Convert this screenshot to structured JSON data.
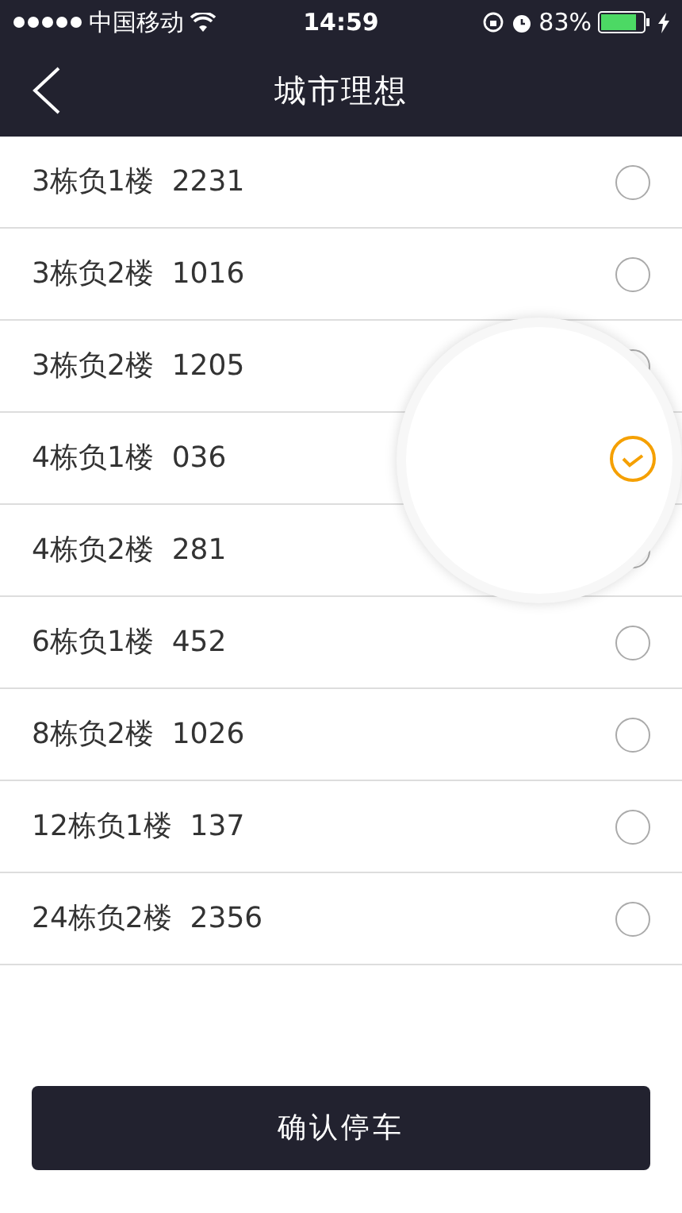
{
  "status_bar": {
    "carrier": "中国移动",
    "time": "14:59",
    "battery": "83%"
  },
  "nav": {
    "title": "城市理想"
  },
  "spots": [
    {
      "label": "3栋负1楼  2231",
      "selected": false
    },
    {
      "label": "3栋负2楼  1016",
      "selected": false
    },
    {
      "label": "3栋负2楼  1205",
      "selected": false
    },
    {
      "label": "4栋负1楼  036",
      "selected": true
    },
    {
      "label": "4栋负2楼  281",
      "selected": false
    },
    {
      "label": "6栋负1楼  452",
      "selected": false
    },
    {
      "label": "8栋负2楼  1026",
      "selected": false
    },
    {
      "label": "12栋负1楼  137",
      "selected": false
    },
    {
      "label": "24栋负2楼  2356",
      "selected": false
    }
  ],
  "confirm_button": "确认停车"
}
